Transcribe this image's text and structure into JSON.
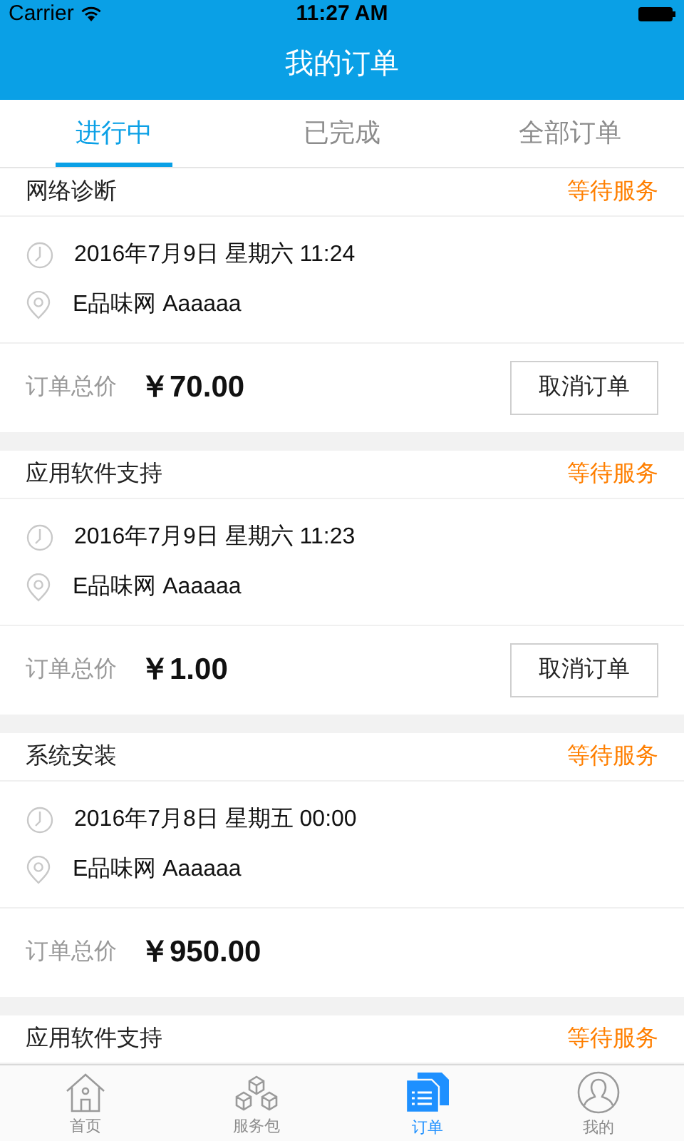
{
  "status_bar": {
    "carrier": "Carrier",
    "time": "11:27 AM"
  },
  "nav_bar": {
    "title": "我的订单"
  },
  "tabs": [
    {
      "label": "进行中",
      "selected": true
    },
    {
      "label": "已完成",
      "selected": false
    },
    {
      "label": "全部订单",
      "selected": false
    }
  ],
  "orders": [
    {
      "service": "网络诊断",
      "status": "等待服务",
      "time": "2016年7月9日 星期六 11:24",
      "location": "E品味网 Aaaaaa",
      "total_label": "订单总价",
      "total": "￥70.00",
      "cancel_button": "取消订单"
    },
    {
      "service": "应用软件支持",
      "status": "等待服务",
      "time": "2016年7月9日 星期六 11:23",
      "location": "E品味网 Aaaaaa",
      "total_label": "订单总价",
      "total": "￥1.00",
      "cancel_button": "取消订单"
    },
    {
      "service": "系统安装",
      "status": "等待服务",
      "time": "2016年7月8日 星期五 00:00",
      "location": "E品味网 Aaaaaa",
      "total_label": "订单总价",
      "total": "￥950.00"
    },
    {
      "service": "应用软件支持",
      "status": "等待服务"
    }
  ],
  "tab_bar": [
    {
      "kind": "home",
      "label": "首页",
      "selected": false
    },
    {
      "kind": "package",
      "label": "服务包",
      "selected": false
    },
    {
      "kind": "orders",
      "label": "订单",
      "selected": true
    },
    {
      "kind": "profile",
      "label": "我的",
      "selected": false
    }
  ]
}
